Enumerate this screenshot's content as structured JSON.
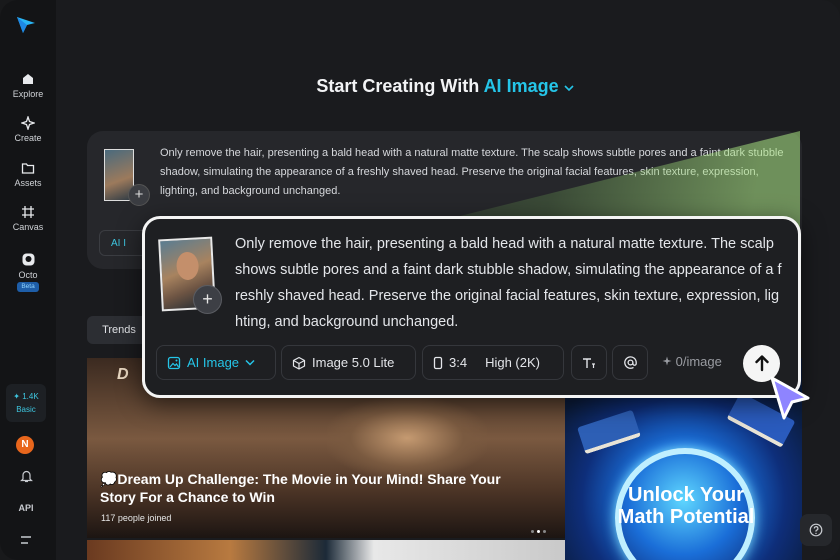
{
  "sidebar": {
    "items": [
      {
        "label": "Explore",
        "icon": "home-icon"
      },
      {
        "label": "Create",
        "icon": "sparkle-icon"
      },
      {
        "label": "Assets",
        "icon": "folder-icon"
      },
      {
        "label": "Canvas",
        "icon": "canvas-icon"
      },
      {
        "label": "Octo",
        "icon": "octo-icon",
        "badge": "Beta"
      }
    ],
    "credits": {
      "amount": "✦ 1.4K",
      "plan": "Basic"
    },
    "avatar_initial": "N",
    "api_label": "API"
  },
  "header": {
    "prefix": "Start Creating With",
    "mode": "AI Image"
  },
  "prompt_panel": {
    "text": "Only remove the hair, presenting a bald head with a natural matte texture. The scalp shows subtle pores and a faint dark stubble shadow, simulating the appearance of a freshly shaved head. Preserve the original facial features, skin texture, expression, lighting, and background unchanged.",
    "chip_label": "AI I"
  },
  "trends_label": "Trends",
  "banner": {
    "logo_text": "D",
    "title": "💭Dream Up Challenge: The Movie in Your Mind! Share Your Story For a Chance to Win",
    "joined": "117  people joined"
  },
  "promo": {
    "text": "Unlock Your Math Potential"
  },
  "card": {
    "text": "Only remove the hair, presenting a bald head with a natural matte texture. The scalp shows subtle pores and a faint dark stubble shadow, simulating the appearance of a freshly shaved head. Preserve the original facial features, skin texture, expression, lighting, and background unchanged.",
    "mode_label": "AI Image",
    "model_label": "Image 5.0 Lite",
    "ratio_label": "3:4",
    "quality_label": "High (2K)",
    "cost_label": "0/image"
  },
  "colors": {
    "accent": "#25c5e8",
    "background": "#1a1b1e"
  }
}
